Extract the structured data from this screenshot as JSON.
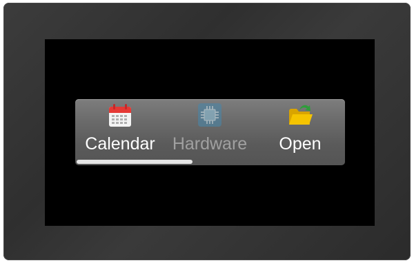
{
  "launcher": {
    "apps": [
      {
        "label": "Calendar",
        "icon": "calendar-icon",
        "enabled": true
      },
      {
        "label": "Hardware",
        "icon": "chip-icon",
        "enabled": false
      },
      {
        "label": "Open",
        "icon": "folder-open-icon",
        "enabled": true
      }
    ],
    "scroll_fraction_visible": 0.43
  },
  "colors": {
    "calendar_header": "#e53935",
    "chip": "#4a86a8",
    "folder": "#f5c400",
    "arrow": "#2e9d3a"
  }
}
